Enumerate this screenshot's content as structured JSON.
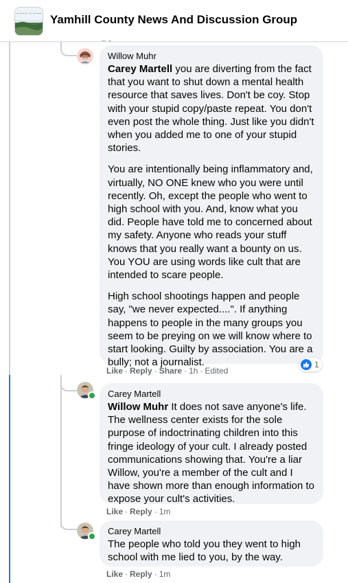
{
  "header": {
    "group_name": "Yamhill County News And Discussion Group"
  },
  "comments": [
    {
      "author": "Willow Muhr",
      "mention": "Carey Martell",
      "paragraphs": [
        " you are diverting from the fact that you want to shut down a mental health resource that saves lives. Don't be coy. Stop with your stupid copy/paste repeat. You don't even post the whole thing. Just like you didn't when you added me to one of your stupid stories.",
        "You are intentionally being inflammatory and, virtually, NO ONE knew who you were until recently. Oh, except the people who went to high school with you. And, know what you did. People have told me to concerned about my safety. Anyone who reads your stuff knows that you really want a bounty on us. You YOU are using words like cult that are intended to scare people.",
        "High school shootings happen and people say, \"we never expected....\". If anything happens to people in the many groups you seem to be preying on we will know where to start looking. Guilty by association. You are a bully; not a journalist."
      ],
      "actions": {
        "like": "Like",
        "reply": "Reply",
        "share": "Share",
        "time": "1h",
        "edited": "Edited"
      },
      "reaction_count": "1"
    },
    {
      "author": "Carey Martell",
      "mention": "Willow Muhr",
      "text": " It does not save anyone's life. The wellness center exists for the sole purpose of indoctrinating children into this fringe ideology of your cult. I already posted communications showing that. You're a liar Willow, you're a member of the cult and I have shown more than enough information to expose your cult's activities.",
      "actions": {
        "like": "Like",
        "reply": "Reply",
        "time": "1m"
      }
    },
    {
      "author": "Carey Martell",
      "text": "The people who told you they went to high school with me lied to you, by the way.",
      "actions": {
        "like": "Like",
        "reply": "Reply",
        "time": "1m"
      }
    }
  ],
  "colors": {
    "link_blue": "#1877f2",
    "bubble_bg": "#f0f2f5",
    "meta_grey": "#65676b",
    "online_green": "#31a24c"
  },
  "icons": [
    "group-avatar-icon",
    "like-reaction-icon",
    "online-status-icon"
  ]
}
